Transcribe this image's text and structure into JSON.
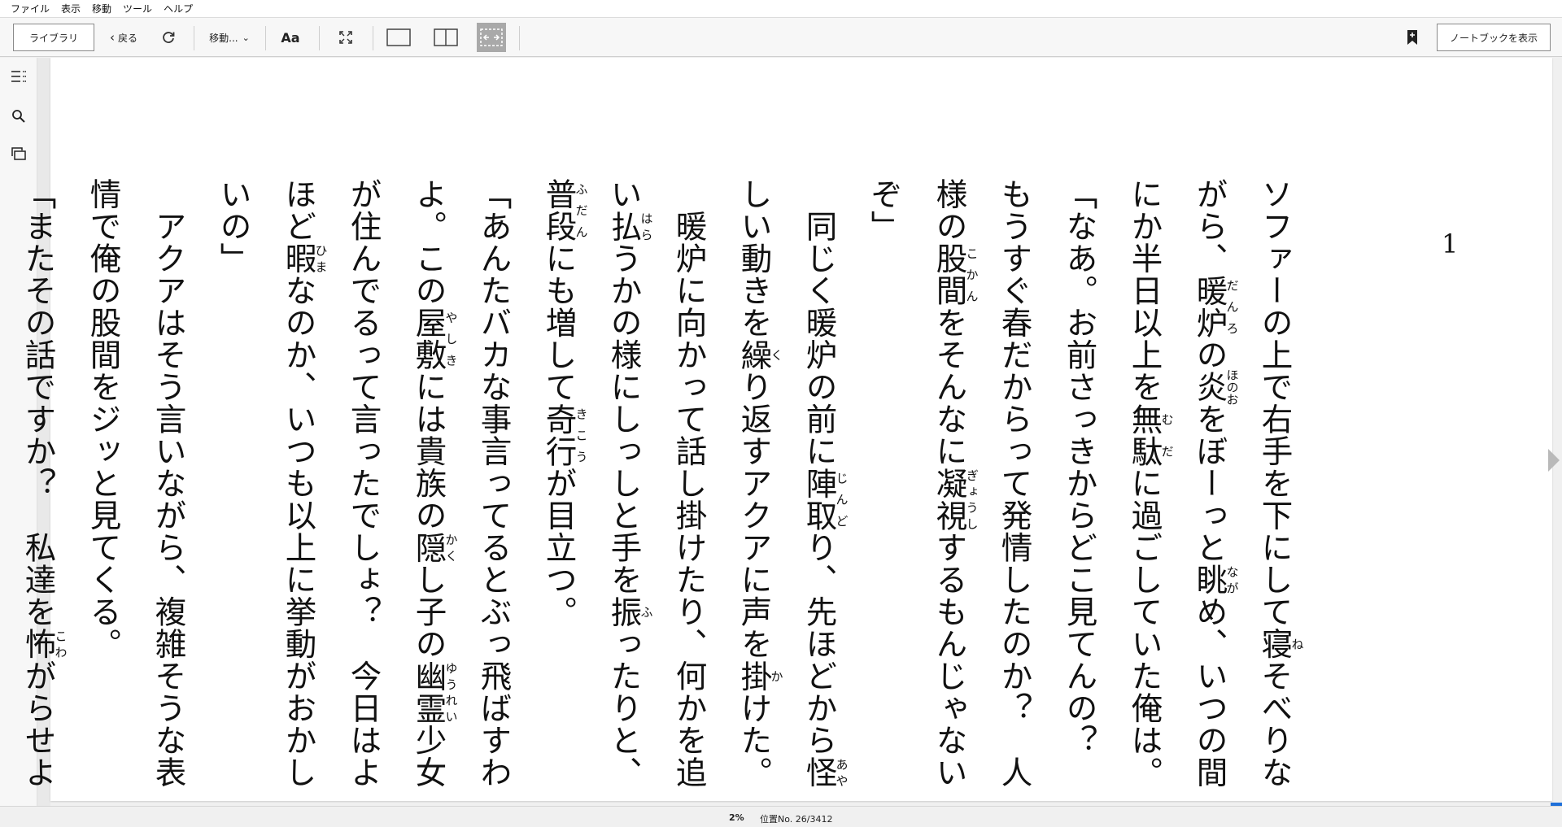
{
  "menubar": {
    "items": [
      "ファイル",
      "表示",
      "移動",
      "ツール",
      "ヘルプ"
    ]
  },
  "toolbar": {
    "library_label": "ライブラリ",
    "back_label": "戻る",
    "goto_label": "移動...",
    "font_label": "Aa",
    "notebook_label": "ノートブックを表示",
    "active_accent": "#a9a9a9"
  },
  "icons": {
    "toc": "toc-icon",
    "search": "search-icon",
    "flashcards": "cards-icon",
    "refresh": "refresh-icon",
    "fullscreen": "fullscreen-icon",
    "single_page": "single-page-icon",
    "two_page": "two-page-icon",
    "fit": "fit-page-icon",
    "bookmark": "bookmark-add-icon",
    "next": "next-page-icon"
  },
  "page": {
    "page_number": "1",
    "paragraphs": [
      [
        {
          "t": "ソファーの上で右手を下にして"
        },
        {
          "t": "寝",
          "r": "ね"
        },
        {
          "t": "そべりながら、"
        },
        {
          "t": "暖炉",
          "r": "だんろ"
        },
        {
          "t": "の"
        },
        {
          "t": "炎",
          "r": "ほのお"
        },
        {
          "t": "をぼーっと"
        },
        {
          "t": "眺",
          "r": "なが"
        },
        {
          "t": "め、いつの間にか半日以上を"
        },
        {
          "t": "無駄",
          "r": "むだ"
        },
        {
          "t": "に過ごしていた俺は。"
        }
      ],
      [
        {
          "t": "「なあ。お前さっきからどこ見てんの？　もうすぐ春だからって発情したのか？　人様の"
        },
        {
          "t": "股間",
          "r": "こかん"
        },
        {
          "t": "をそんなに"
        },
        {
          "t": "凝視",
          "r": "ぎょうし"
        },
        {
          "t": "するもんじゃないぞ」"
        }
      ],
      [
        {
          "t": "　同じく暖炉の前に"
        },
        {
          "t": "陣取",
          "r": "じんど"
        },
        {
          "t": "り、先ほどから"
        },
        {
          "t": "怪",
          "r": "あや"
        },
        {
          "t": "しい動きを"
        },
        {
          "t": "繰",
          "r": "く"
        },
        {
          "t": "り返すアクアに声を"
        },
        {
          "t": "掛",
          "r": "か"
        },
        {
          "t": "けた。"
        }
      ],
      [
        {
          "t": "　暖炉に向かって話し掛けたり、何かを追い"
        },
        {
          "t": "払",
          "r": "はら"
        },
        {
          "t": "うかの様にしっしと手を"
        },
        {
          "t": "振",
          "r": "ふ"
        },
        {
          "t": "ったりと、"
        },
        {
          "t": "普段",
          "r": "ふだん"
        },
        {
          "t": "にも増して"
        },
        {
          "t": "奇行",
          "r": "きこう"
        },
        {
          "t": "が目立つ。"
        }
      ],
      [
        {
          "t": "「あんたバカな事言ってるとぶっ飛ばすわよ。この"
        },
        {
          "t": "屋敷",
          "r": "やしき"
        },
        {
          "t": "には貴族の"
        },
        {
          "t": "隠",
          "r": "かく"
        },
        {
          "t": "し子の"
        },
        {
          "t": "幽霊",
          "r": "ゆうれい"
        },
        {
          "t": "少女が住んでるって言ったでしょ？　今日はよほど"
        },
        {
          "t": "暇",
          "r": "ひま"
        },
        {
          "t": "なのか、いつも以上に挙動がおかしいの」"
        }
      ],
      [
        {
          "t": "　アクアはそう言いながら、複雑そうな表情で俺の股間をジッと見てくる。"
        }
      ],
      [
        {
          "t": "「またその話ですか？　私達を"
        },
        {
          "t": "怖",
          "r": "こわ"
        },
        {
          "t": "がらせようとしてもそうはいきませんよ？　……ちなみに、"
        }
      ]
    ]
  },
  "status": {
    "percent": "2%",
    "location": "位置No. 26/3412"
  }
}
